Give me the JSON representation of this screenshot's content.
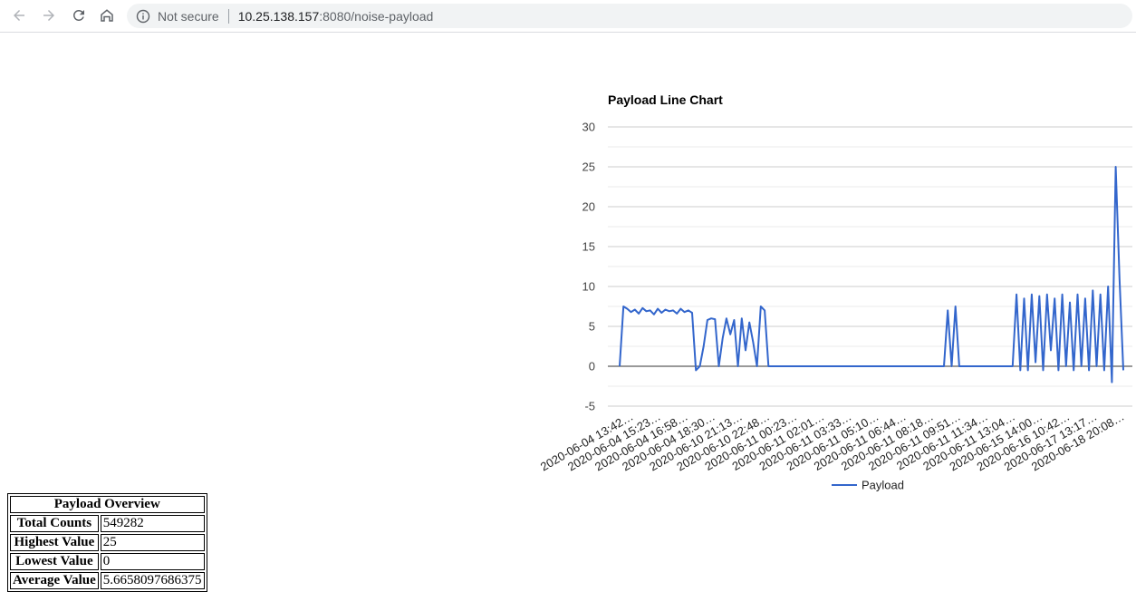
{
  "browser": {
    "security_text": "Not secure",
    "url_host": "10.25.138.157",
    "url_rest": ":8080/noise-payload",
    "icons": [
      "back-arrow-icon",
      "forward-arrow-icon",
      "reload-icon",
      "home-icon",
      "info-icon"
    ]
  },
  "chart_data": {
    "type": "line",
    "title": "Payload Line Chart",
    "xlabel": "",
    "ylabel": "",
    "ylim": [
      -5,
      30
    ],
    "yticks": [
      -5,
      0,
      5,
      10,
      15,
      20,
      25,
      30
    ],
    "grid": true,
    "legend_position": "bottom",
    "color": "#3366cc",
    "categories": [
      "2020-06-04 13:42…",
      "2020-06-04 15:23…",
      "2020-06-04 16:58…",
      "2020-06-04 18:30…",
      "2020-06-10 21:13…",
      "2020-06-10 22:48…",
      "2020-06-11 00:23…",
      "2020-06-11 02:01…",
      "2020-06-11 03:33…",
      "2020-06-11 05:10…",
      "2020-06-11 06:44…",
      "2020-06-11 08:18…",
      "2020-06-11 09:51…",
      "2020-06-11 11:34…",
      "2020-06-11 13:04…",
      "2020-06-15 14:00…",
      "2020-06-16 10:42…",
      "2020-06-17 13:17…",
      "2020-06-18 20:08…"
    ],
    "series": [
      {
        "name": "Payload",
        "values": [
          0,
          7.5,
          7.2,
          6.8,
          7.1,
          6.6,
          7.3,
          6.9,
          7.0,
          6.5,
          7.2,
          6.7,
          7.1,
          6.9,
          7.0,
          6.6,
          7.2,
          6.8,
          7.0,
          6.7,
          -0.5,
          0,
          2.5,
          5.8,
          6.0,
          5.9,
          0,
          3.5,
          6.0,
          4.0,
          5.8,
          0,
          6.0,
          2.0,
          5.5,
          3.0,
          0,
          7.5,
          7.0,
          0,
          0,
          0,
          0,
          0,
          0,
          0,
          0,
          0,
          0,
          0,
          0,
          0,
          0,
          0,
          0,
          0,
          0,
          0,
          0,
          0,
          0,
          0,
          0,
          0,
          0,
          0,
          0,
          0,
          0,
          0,
          0,
          0,
          0,
          0,
          0,
          0,
          0,
          0,
          0,
          0,
          0,
          0,
          0,
          0,
          0,
          0,
          7.0,
          0,
          7.5,
          0,
          0,
          0,
          0,
          0,
          0,
          0,
          0,
          0,
          0,
          0,
          0,
          0,
          0,
          0,
          9.0,
          -0.5,
          8.5,
          -0.5,
          9.0,
          0.5,
          8.8,
          -0.5,
          9.0,
          2.0,
          8.5,
          -0.5,
          9.0,
          0,
          8.0,
          -0.5,
          9.0,
          0,
          8.5,
          -0.5,
          9.5,
          0,
          9.0,
          -0.5,
          10.0,
          -2.0,
          25.0,
          11.0,
          -0.5
        ]
      }
    ]
  },
  "overview": {
    "title": "Payload Overview",
    "rows": [
      {
        "label": "Total Counts",
        "value": "549282"
      },
      {
        "label": "Highest Value",
        "value": "25"
      },
      {
        "label": "Lowest Value",
        "value": "0"
      },
      {
        "label": "Average Value",
        "value": "5.6658097686375"
      }
    ]
  }
}
